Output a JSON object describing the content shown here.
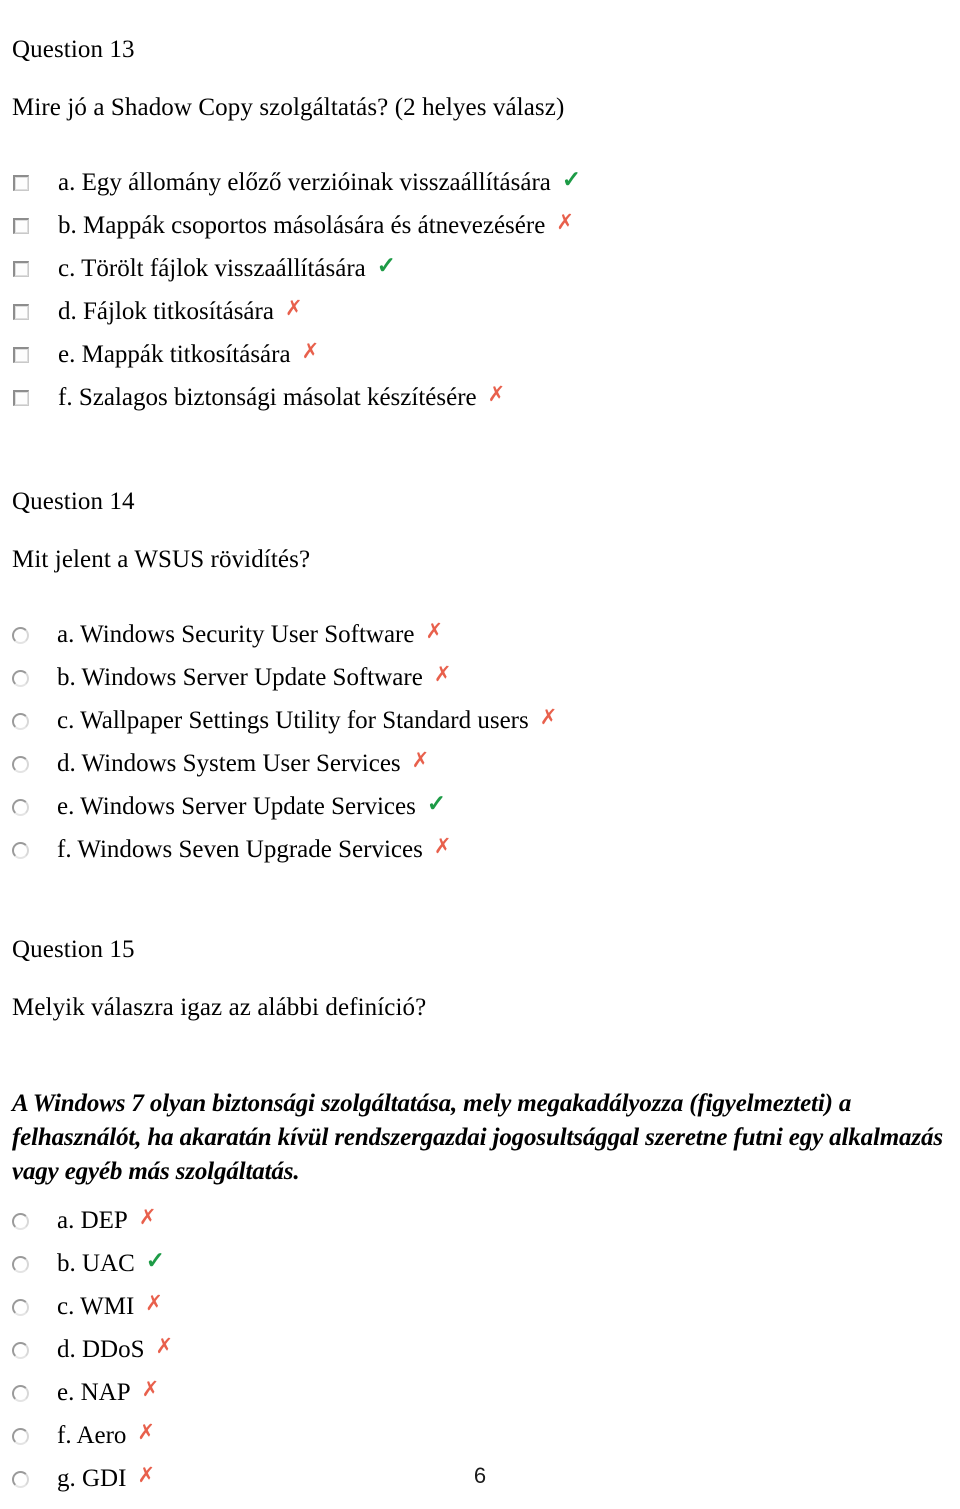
{
  "page": {
    "footer_page_number": "6",
    "colors": {
      "correct_mark": "#1d9b46",
      "wrong_mark": "#e8604c",
      "text": "#000000",
      "background": "#ffffff",
      "control_bevel": "#8d8d8d"
    }
  },
  "questions": [
    {
      "number": "Question 13",
      "text": "Mire jó a Shadow Copy szolgáltatás? (2 helyes válasz)",
      "control_type": "checkbox",
      "options": [
        {
          "label": "a. Egy állomány előző verzióinak visszaállítására",
          "mark": "✓",
          "mark_type": "correct"
        },
        {
          "label": "b. Mappák csoportos másolására és átnevezésére",
          "mark": "✗",
          "mark_type": "wrong"
        },
        {
          "label": "c. Törölt fájlok visszaállítására",
          "mark": "✓",
          "mark_type": "correct"
        },
        {
          "label": "d. Fájlok titkosítására",
          "mark": "✗",
          "mark_type": "wrong"
        },
        {
          "label": "e. Mappák titkosítására",
          "mark": "✗",
          "mark_type": "wrong"
        },
        {
          "label": "f. Szalagos biztonsági másolat készítésére",
          "mark": "✗",
          "mark_type": "wrong"
        }
      ]
    },
    {
      "number": "Question 14",
      "text": "Mit jelent a WSUS rövidítés?",
      "control_type": "radio",
      "options": [
        {
          "label": "a. Windows Security User Software",
          "mark": "✗",
          "mark_type": "wrong"
        },
        {
          "label": "b. Windows Server Update Software",
          "mark": "✗",
          "mark_type": "wrong"
        },
        {
          "label": "c. Wallpaper Settings Utility for Standard users",
          "mark": "✗",
          "mark_type": "wrong"
        },
        {
          "label": "d. Windows System User Services",
          "mark": "✗",
          "mark_type": "wrong"
        },
        {
          "label": "e. Windows Server Update Services",
          "mark": "✓",
          "mark_type": "correct"
        },
        {
          "label": "f. Windows Seven Upgrade Services",
          "mark": "✗",
          "mark_type": "wrong"
        }
      ]
    },
    {
      "number": "Question 15",
      "text": "Melyik válaszra igaz az alábbi definíció?",
      "control_type": "radio",
      "definition": "A Windows 7 olyan biztonsági szolgáltatása, mely megakadályozza (figyelmezteti) a felhasználót, ha akaratán kívül rendszergazdai jogosultsággal szeretne futni egy alkalmazás vagy egyéb más szolgáltatás.",
      "options": [
        {
          "label": "a. DEP",
          "mark": "✗",
          "mark_type": "wrong"
        },
        {
          "label": "b. UAC",
          "mark": "✓",
          "mark_type": "correct"
        },
        {
          "label": "c. WMI",
          "mark": "✗",
          "mark_type": "wrong"
        },
        {
          "label": "d. DDoS",
          "mark": "✗",
          "mark_type": "wrong"
        },
        {
          "label": "e. NAP",
          "mark": "✗",
          "mark_type": "wrong"
        },
        {
          "label": "f. Aero",
          "mark": "✗",
          "mark_type": "wrong"
        },
        {
          "label": "g. GDI",
          "mark": "✗",
          "mark_type": "wrong"
        }
      ]
    }
  ]
}
